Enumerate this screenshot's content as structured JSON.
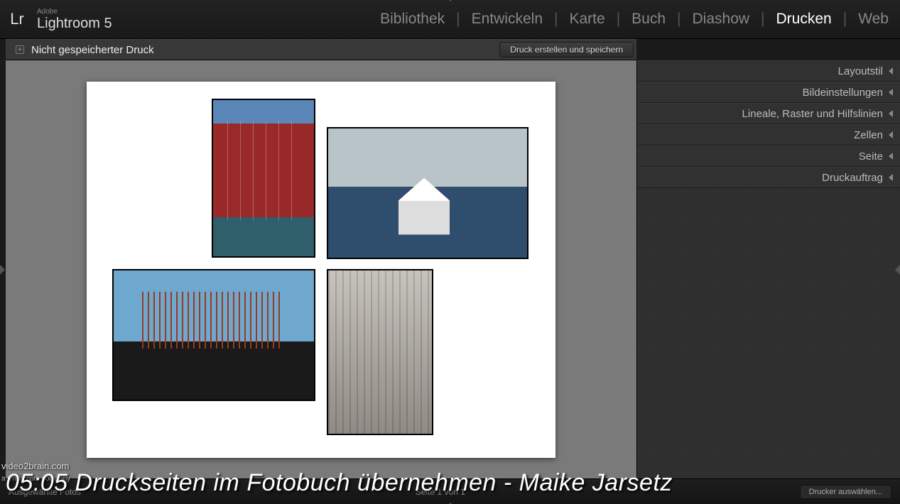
{
  "brand": {
    "sub": "Adobe",
    "main": "Lightroom 5",
    "logo": "Lr"
  },
  "modules": [
    {
      "label": "Bibliothek",
      "active": false
    },
    {
      "label": "Entwickeln",
      "active": false
    },
    {
      "label": "Karte",
      "active": false
    },
    {
      "label": "Buch",
      "active": false
    },
    {
      "label": "Diashow",
      "active": false
    },
    {
      "label": "Drucken",
      "active": true
    },
    {
      "label": "Web",
      "active": false
    }
  ],
  "subbar": {
    "title": "Nicht gespeicherter Druck",
    "button": "Druck erstellen und speichern"
  },
  "right_panels": [
    "Layoutstil",
    "Bildeinstellungen",
    "Lineale, Raster und Hilfslinien",
    "Zellen",
    "Seite",
    "Druckauftrag"
  ],
  "footer": {
    "filmstrip_label": "Ausgewählte Fotos",
    "page_label": "Seite 1 von 1",
    "button_right": "Drucker auswählen..."
  },
  "overlay": {
    "timecode": "05:05",
    "caption": "Druckseiten im Fotobuch übernehmen - Maike Jarsetz",
    "brand": "video2brain.com",
    "sub": "a lynda.com company"
  }
}
